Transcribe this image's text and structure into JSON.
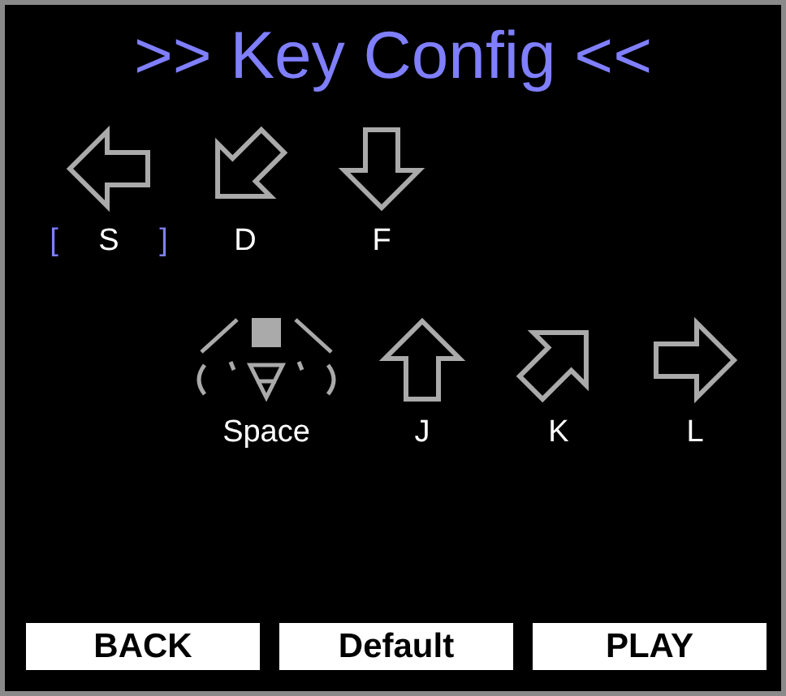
{
  "title": ">> Key Config <<",
  "cursor": {
    "left": "[",
    "right": "]"
  },
  "rows": [
    {
      "keys": [
        {
          "kind": "left",
          "label": "S",
          "selected": true
        },
        {
          "kind": "down-left",
          "label": "D",
          "selected": false
        },
        {
          "kind": "down",
          "label": "F",
          "selected": false
        }
      ]
    },
    {
      "keys": [
        {
          "kind": "space",
          "label": "Space",
          "selected": false
        },
        {
          "kind": "up",
          "label": "J",
          "selected": false
        },
        {
          "kind": "up-right",
          "label": "K",
          "selected": false
        },
        {
          "kind": "right",
          "label": "L",
          "selected": false
        }
      ]
    }
  ],
  "buttons": [
    "BACK",
    "Default",
    "PLAY"
  ]
}
